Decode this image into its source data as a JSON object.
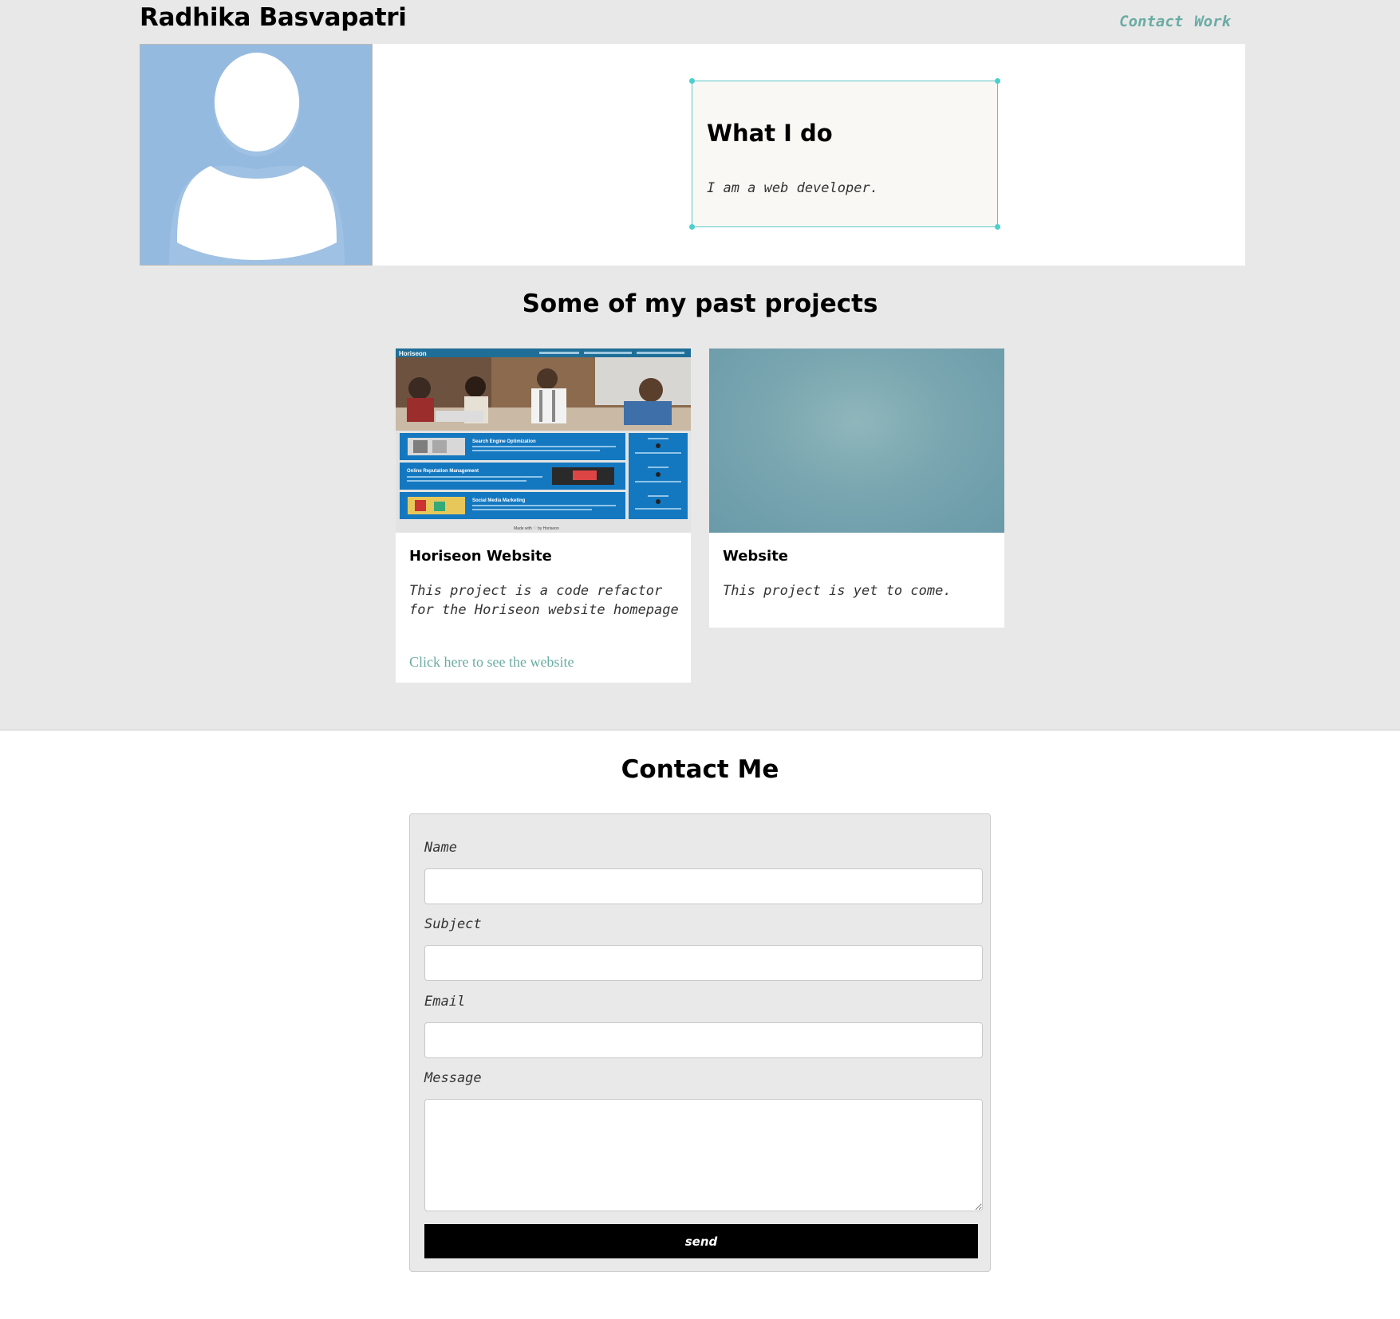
{
  "header": {
    "site_title": "Radhika Basvapatri",
    "nav": [
      {
        "label": "Contact"
      },
      {
        "label": "Work"
      }
    ]
  },
  "hero": {
    "card_title": "What I do",
    "card_text": "I am a web developer."
  },
  "projects": {
    "title": "Some of my past projects",
    "items": [
      {
        "title": "Horiseon Website",
        "description": "This project is a code refactor for the Horiseon website homepage",
        "link_text": "Click here to see the website",
        "thumb_header": "Horiseon",
        "thumb_sections": [
          "Search Engine Optimization",
          "Online Reputation Management",
          "Social Media Marketing"
        ],
        "thumb_footer": "Made with ♡ by Horiseon"
      },
      {
        "title": "Website",
        "description": "This project is yet to come."
      }
    ]
  },
  "contact": {
    "title": "Contact Me",
    "fields": {
      "name_label": "Name",
      "subject_label": "Subject",
      "email_label": "Email",
      "message_label": "Message"
    },
    "send_label": "send"
  },
  "colors": {
    "accent": "#6aaca3",
    "band": "#e8e8e8",
    "avatar_bg": "#95bae0",
    "selection": "#5ec8c8",
    "button": "#000000"
  }
}
